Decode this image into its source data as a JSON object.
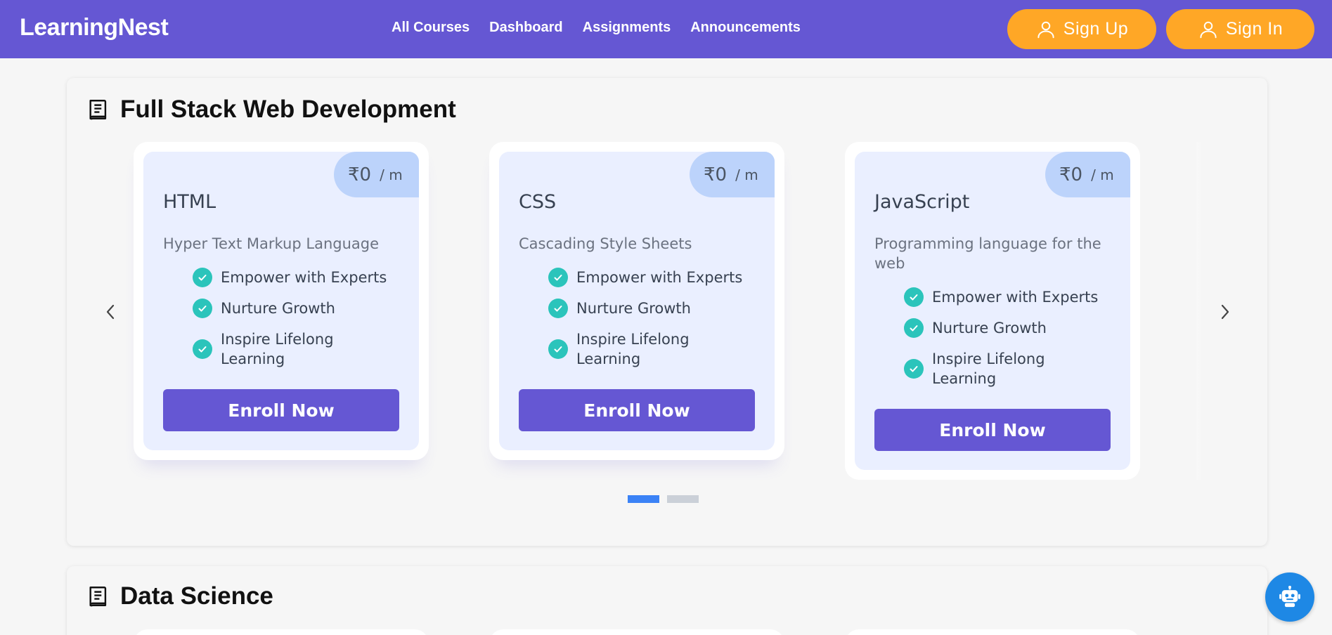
{
  "app": {
    "logo": "LearningNest"
  },
  "nav": [
    "All Courses",
    "Dashboard",
    "Assignments",
    "Announcements"
  ],
  "auth": {
    "signup": "Sign Up",
    "signin": "Sign In"
  },
  "sections": [
    {
      "title": "Full Stack Web Development",
      "courses": [
        {
          "price": "₹0",
          "period": "/ m",
          "title": "HTML",
          "desc": "Hyper Text Markup Language",
          "features": [
            "Empower with Experts",
            "Nurture Growth",
            "Inspire Lifelong Learning"
          ],
          "cta": "Enroll Now"
        },
        {
          "price": "₹0",
          "period": "/ m",
          "title": "CSS",
          "desc": "Cascading Style Sheets",
          "features": [
            "Empower with Experts",
            "Nurture Growth",
            "Inspire Lifelong Learning"
          ],
          "cta": "Enroll Now"
        },
        {
          "price": "₹0",
          "period": "/ m",
          "title": "JavaScript",
          "desc": "Programming language for the web",
          "features": [
            "Empower with Experts",
            "Nurture Growth",
            "Inspire Lifelong Learning"
          ],
          "cta": "Enroll Now"
        }
      ],
      "carousel": {
        "pages": 2,
        "active_page": 1
      }
    },
    {
      "title": "Data Science"
    }
  ],
  "icons": {
    "section": "book-icon",
    "auth": "user-icon",
    "prev": "chevron-left-icon",
    "next": "chevron-right-icon",
    "feature": "check-circle-icon",
    "chat": "robot-icon"
  },
  "colors": {
    "header": "#6557d3",
    "auth_button": "#ffa726",
    "card_bg": "#eaefff",
    "price_bg": "#bcd3fb",
    "check": "#2bc4bb",
    "enroll": "#6557d3",
    "dot_active": "#3b82f6",
    "dot_inactive": "#cbd0d8",
    "chatbot": "#1e88e5"
  }
}
